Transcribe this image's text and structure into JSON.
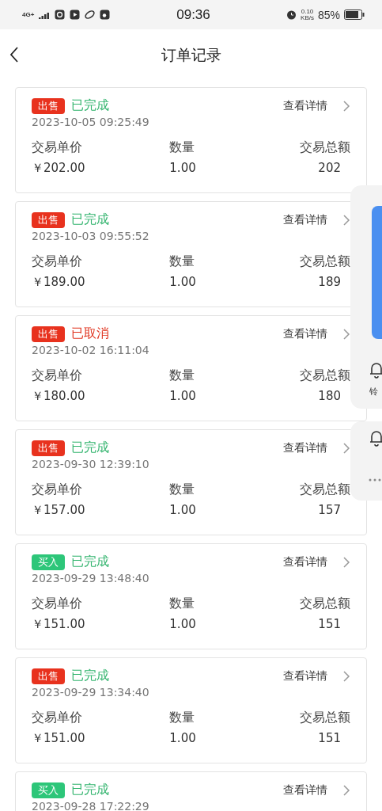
{
  "status_bar": {
    "network": "4G+",
    "time": "09:36",
    "speed_value": "0.10",
    "speed_unit": "KB/s",
    "battery": "85%"
  },
  "header": {
    "title": "订单记录"
  },
  "orders": [
    {
      "tag": {
        "label": "出售",
        "kind": "sell"
      },
      "status": {
        "label": "已完成",
        "kind": "done"
      },
      "detail": "查看详情",
      "datetime": "2023-10-05 09:25:49",
      "labels": [
        "交易单价",
        "数量",
        "交易总额"
      ],
      "price": "￥202.00",
      "quantity": "1.00",
      "total": "202"
    },
    {
      "tag": {
        "label": "出售",
        "kind": "sell"
      },
      "status": {
        "label": "已完成",
        "kind": "done"
      },
      "detail": "查看详情",
      "datetime": "2023-10-03 09:55:52",
      "labels": [
        "交易单价",
        "数量",
        "交易总额"
      ],
      "price": "￥189.00",
      "quantity": "1.00",
      "total": "189"
    },
    {
      "tag": {
        "label": "出售",
        "kind": "sell"
      },
      "status": {
        "label": "已取消",
        "kind": "cancelled"
      },
      "detail": "查看详情",
      "datetime": "2023-10-02 16:11:04",
      "labels": [
        "交易单价",
        "数量",
        "交易总额"
      ],
      "price": "￥180.00",
      "quantity": "1.00",
      "total": "180"
    },
    {
      "tag": {
        "label": "出售",
        "kind": "sell"
      },
      "status": {
        "label": "已完成",
        "kind": "done"
      },
      "detail": "查看详情",
      "datetime": "2023-09-30 12:39:10",
      "labels": [
        "交易单价",
        "数量",
        "交易总额"
      ],
      "price": "￥157.00",
      "quantity": "1.00",
      "total": "157"
    },
    {
      "tag": {
        "label": "买入",
        "kind": "buy"
      },
      "status": {
        "label": "已完成",
        "kind": "done"
      },
      "detail": "查看详情",
      "datetime": "2023-09-29 13:48:40",
      "labels": [
        "交易单价",
        "数量",
        "交易总额"
      ],
      "price": "￥151.00",
      "quantity": "1.00",
      "total": "151"
    },
    {
      "tag": {
        "label": "出售",
        "kind": "sell"
      },
      "status": {
        "label": "已完成",
        "kind": "done"
      },
      "detail": "查看详情",
      "datetime": "2023-09-29 13:34:40",
      "labels": [
        "交易单价",
        "数量",
        "交易总额"
      ],
      "price": "￥151.00",
      "quantity": "1.00",
      "total": "151"
    },
    {
      "tag": {
        "label": "买入",
        "kind": "buy"
      },
      "status": {
        "label": "已完成",
        "kind": "done"
      },
      "detail": "查看详情",
      "datetime": "2023-09-28 17:22:29"
    }
  ],
  "floating_panel": {
    "label": "铃"
  }
}
